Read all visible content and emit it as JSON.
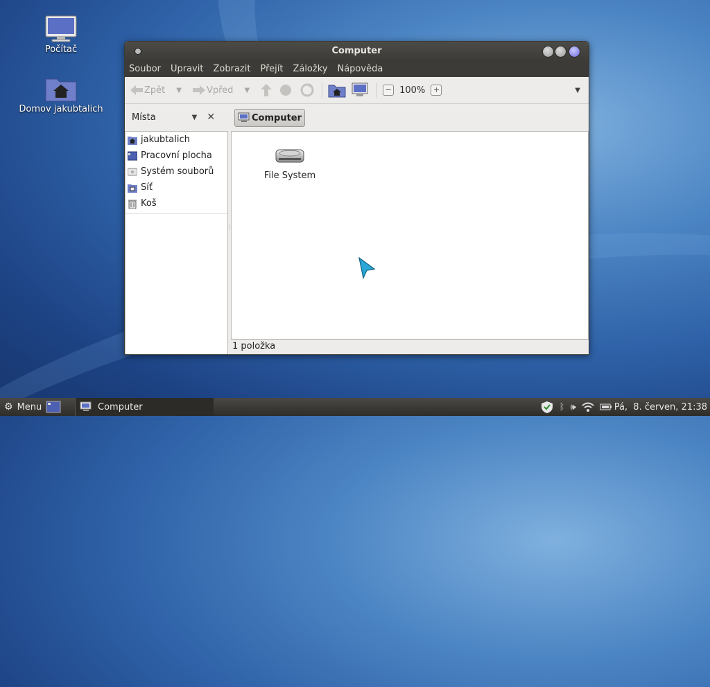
{
  "desktop": {
    "icons": [
      {
        "label": "Počítač",
        "icon": "computer-icon"
      },
      {
        "label": "Domov jakubtalich",
        "icon": "home-folder-icon"
      }
    ]
  },
  "window": {
    "title": "Computer",
    "menu": [
      "Soubor",
      "Upravit",
      "Zobrazit",
      "Přejít",
      "Záložky",
      "Nápověda"
    ],
    "toolbar": {
      "back_label": "Zpět",
      "forward_label": "Vpřed",
      "zoom": "100%"
    },
    "places_title": "Místa",
    "breadcrumb": "Computer",
    "places": [
      {
        "label": "jakubtalich",
        "icon": "home-icon"
      },
      {
        "label": "Pracovní plocha",
        "icon": "desktop-icon"
      },
      {
        "label": "Systém souborů",
        "icon": "drive-icon"
      },
      {
        "label": "Síť",
        "icon": "network-icon"
      },
      {
        "label": "Koš",
        "icon": "trash-icon"
      }
    ],
    "items": [
      {
        "label": "File System",
        "icon": "harddisk-icon"
      }
    ],
    "status": "1 položka"
  },
  "taskbar": {
    "menu_label": "Menu",
    "task_label": "Computer",
    "clock": "Pá,  8. červen, 21:38"
  },
  "colors": {
    "accent": "#6b6bd9",
    "titlebar": "#3c3b37"
  }
}
